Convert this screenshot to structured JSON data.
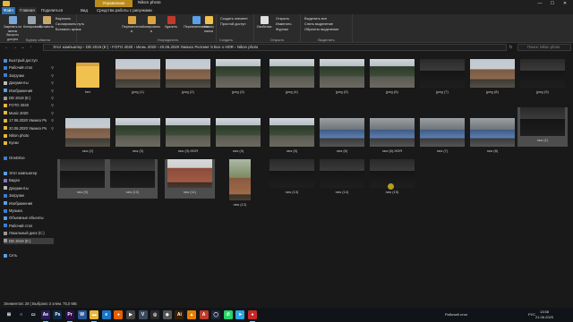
{
  "window": {
    "context_tab": "Управление",
    "title": "Nikon photo",
    "controls": [
      "—",
      "☐",
      "✕"
    ]
  },
  "tabs": [
    "Файл",
    "Главная",
    "Поделиться",
    "Вид",
    "Средства работы с рисунками"
  ],
  "ribbon": {
    "clipboard": {
      "label": "Буфер обмена",
      "pin": "Закрепить на панели быстрого доступа",
      "copy": "Копировать",
      "paste": "Вставить",
      "cut": "Вырезать",
      "copy_path": "Скопировать путь",
      "paste_shortcut": "Вставить ярлык"
    },
    "organize": {
      "label": "Упорядочить",
      "move_to": "Переместить в",
      "copy_to": "Копировать в",
      "delete": "Удалить",
      "rename": "Переименовать"
    },
    "new": {
      "label": "Создать",
      "new_folder": "Новая папка",
      "new_item": "Создать элемент",
      "easy_access": "Простой доступ"
    },
    "open": {
      "label": "Открыть",
      "properties": "Свойства",
      "open": "Открыть",
      "edit": "Изменить",
      "history": "Журнал"
    },
    "select": {
      "label": "Выделить",
      "select_all": "Выделить все",
      "select_none": "Снять выделение",
      "invert": "Обратить выделение"
    }
  },
  "address": {
    "path": "Этот компьютер  ›  DD 2019 (E:)  ›  FOTO 2020  ›  Июнь 2020  ›  20.06.2020 Уманск Роллинг 9 Все о HDR  ›  Nikon photo",
    "search_placeholder": "Поиск: Nikon photo"
  },
  "nav": [
    {
      "label": "Быстрый доступ",
      "icon": "star-icon",
      "color": "#4a90d9",
      "pinned": false
    },
    {
      "label": "Рабочий стол",
      "icon": "desktop-icon",
      "color": "#3b7dd8",
      "pinned": true
    },
    {
      "label": "Загрузки",
      "icon": "download-icon",
      "color": "#3b7dd8",
      "pinned": true
    },
    {
      "label": "Документы",
      "icon": "document-icon",
      "color": "#bbbbbb",
      "pinned": true
    },
    {
      "label": "Изображения",
      "icon": "pictures-icon",
      "color": "#5aa0e6",
      "pinned": true
    },
    {
      "label": "DD 2019 (E:)",
      "icon": "drive-icon",
      "color": "#999999",
      "pinned": true
    },
    {
      "label": "FOTO 2020",
      "icon": "folder-icon",
      "color": "#e8b63a",
      "pinned": true
    },
    {
      "label": "Music 2020",
      "icon": "folder-icon",
      "color": "#e8b63a",
      "pinned": true
    },
    {
      "label": "17.06.2020 Уманск Ро",
      "icon": "folder-icon",
      "color": "#e8b63a",
      "pinned": true
    },
    {
      "label": "20.06.2020 Уманск Ро",
      "icon": "folder-icon",
      "color": "#e8b63a",
      "pinned": true
    },
    {
      "label": "Nikon photo",
      "icon": "folder-icon",
      "color": "#e8b63a",
      "pinned": false
    },
    {
      "label": "Куски",
      "icon": "folder-icon",
      "color": "#e8b63a",
      "pinned": false
    },
    {
      "label": "",
      "icon": "",
      "color": "",
      "pinned": false
    },
    {
      "label": "OneDrive",
      "icon": "cloud-icon",
      "color": "#3b7dd8",
      "pinned": false
    },
    {
      "label": "",
      "icon": "",
      "color": "",
      "pinned": false
    },
    {
      "label": "Этот компьютер",
      "icon": "computer-icon",
      "color": "#5aa0e6",
      "pinned": false
    },
    {
      "label": "Видео",
      "icon": "video-icon",
      "color": "#8a6fd1",
      "pinned": false
    },
    {
      "label": "Документы",
      "icon": "document-icon",
      "color": "#bbbbbb",
      "pinned": false
    },
    {
      "label": "Загрузки",
      "icon": "download-icon",
      "color": "#3b7dd8",
      "pinned": false
    },
    {
      "label": "Изображения",
      "icon": "pictures-icon",
      "color": "#5aa0e6",
      "pinned": false
    },
    {
      "label": "Музыка",
      "icon": "music-icon",
      "color": "#3b7dd8",
      "pinned": false
    },
    {
      "label": "Объемные объекты",
      "icon": "cube-icon",
      "color": "#5aa0e6",
      "pinned": false
    },
    {
      "label": "Рабочий стол",
      "icon": "desktop-icon",
      "color": "#3b7dd8",
      "pinned": false
    },
    {
      "label": "Локальный диск (C:)",
      "icon": "drive-icon",
      "color": "#999999",
      "pinned": false
    },
    {
      "label": "DD 2019 (E:)",
      "icon": "drive-icon",
      "color": "#999999",
      "pinned": false,
      "selected": true
    },
    {
      "label": "",
      "icon": "",
      "color": "",
      "pinned": false
    },
    {
      "label": "Сеть",
      "icon": "network-icon",
      "color": "#5aa0e6",
      "pinned": false
    }
  ],
  "files": [
    {
      "name": "hev",
      "kind": "folder",
      "scene": "none"
    },
    {
      "name": "jpeg (1)",
      "kind": "image",
      "scene": "building"
    },
    {
      "name": "jpeg (2)",
      "kind": "image",
      "scene": "building"
    },
    {
      "name": "jpeg (3)",
      "kind": "image",
      "scene": "trees"
    },
    {
      "name": "jpeg (4)",
      "kind": "image",
      "scene": "trees"
    },
    {
      "name": "jpeg (5)",
      "kind": "image",
      "scene": "trees"
    },
    {
      "name": "jpeg (6)",
      "kind": "image",
      "scene": "trees"
    },
    {
      "name": "jpeg (7)",
      "kind": "image",
      "scene": "dark"
    },
    {
      "name": "jpeg (8)",
      "kind": "image",
      "scene": "building"
    },
    {
      "name": "jpeg (9)",
      "kind": "image",
      "scene": "dark"
    },
    {
      "name": "raw (1)",
      "kind": "image",
      "scene": "dark",
      "selected": true
    },
    {
      "name": "raw (2)",
      "kind": "image",
      "scene": "building"
    },
    {
      "name": "raw (3)",
      "kind": "image",
      "scene": "trees"
    },
    {
      "name": "raw (3)-HDR",
      "kind": "image",
      "scene": "trees"
    },
    {
      "name": "raw (4)",
      "kind": "image",
      "scene": "trees"
    },
    {
      "name": "raw (5)",
      "kind": "image",
      "scene": "trees"
    },
    {
      "name": "raw (6)",
      "kind": "image",
      "scene": "car"
    },
    {
      "name": "raw (6)-HDR",
      "kind": "image",
      "scene": "car"
    },
    {
      "name": "raw (7)",
      "kind": "image",
      "scene": "car"
    },
    {
      "name": "raw (8)",
      "kind": "image",
      "scene": "car"
    },
    {
      "name": "raw (9)",
      "kind": "image",
      "scene": "dark",
      "selected": true
    },
    {
      "name": "raw (10)",
      "kind": "image",
      "scene": "dark",
      "selected": true
    },
    {
      "name": "raw (11)",
      "kind": "image",
      "scene": "brick",
      "selected": true
    },
    {
      "name": "raw (12)",
      "kind": "image",
      "scene": "portrait"
    },
    {
      "name": "raw (13)",
      "kind": "image",
      "scene": "dark"
    },
    {
      "name": "raw (14)",
      "kind": "image",
      "scene": "dark"
    },
    {
      "name": "raw (15)",
      "kind": "image",
      "scene": "dark"
    }
  ],
  "status": "Элементов: 28  |  Выбрано 3 элем. 75,0 МБ",
  "taskbar": {
    "apps": [
      {
        "name": "start-icon",
        "glyph": "⊞",
        "color": "#101418",
        "running": false
      },
      {
        "name": "search-icon",
        "glyph": "○",
        "color": "#101418",
        "running": false
      },
      {
        "name": "task-view-icon",
        "glyph": "▭",
        "color": "#101418",
        "running": false
      },
      {
        "name": "after-effects-icon",
        "glyph": "Ae",
        "color": "#2a1c5a",
        "running": true
      },
      {
        "name": "photoshop-icon",
        "glyph": "Ps",
        "color": "#0b2a4a",
        "running": false
      },
      {
        "name": "premiere-icon",
        "glyph": "Pr",
        "color": "#2c0f4a",
        "running": true
      },
      {
        "name": "word-icon",
        "glyph": "W",
        "color": "#2b5797",
        "running": false
      },
      {
        "name": "explorer-icon",
        "glyph": "▬",
        "color": "#e8b63a",
        "running": true
      },
      {
        "name": "edge-icon",
        "glyph": "e",
        "color": "#1b76c6",
        "running": false
      },
      {
        "name": "firefox-icon",
        "glyph": "●",
        "color": "#e66000",
        "running": false
      },
      {
        "name": "media-icon",
        "glyph": "▶",
        "color": "#444444",
        "running": false
      },
      {
        "name": "vegas-icon",
        "glyph": "V",
        "color": "#3a4a5a",
        "running": false
      },
      {
        "name": "chrome-icon",
        "glyph": "◎",
        "color": "#2a2a2a",
        "running": false
      },
      {
        "name": "app-icon",
        "glyph": "◆",
        "color": "#555555",
        "running": false
      },
      {
        "name": "illustrator-icon",
        "glyph": "Ai",
        "color": "#3a1f00",
        "running": false
      },
      {
        "name": "vlc-icon",
        "glyph": "▲",
        "color": "#e67e00",
        "running": false
      },
      {
        "name": "pdf-icon",
        "glyph": "A",
        "color": "#c0392b",
        "running": false
      },
      {
        "name": "steam-icon",
        "glyph": "◯",
        "color": "#1b2838",
        "running": false
      },
      {
        "name": "whatsapp-icon",
        "glyph": "✆",
        "color": "#25d366",
        "running": false
      },
      {
        "name": "telegram-icon",
        "glyph": "➤",
        "color": "#2ca5e0",
        "running": false
      },
      {
        "name": "record-icon",
        "glyph": "●",
        "color": "#c62828",
        "running": true
      }
    ],
    "tray_label": "Рабочий стол",
    "time": "13:58",
    "date": "21.06.2020",
    "lang": "РУС"
  }
}
